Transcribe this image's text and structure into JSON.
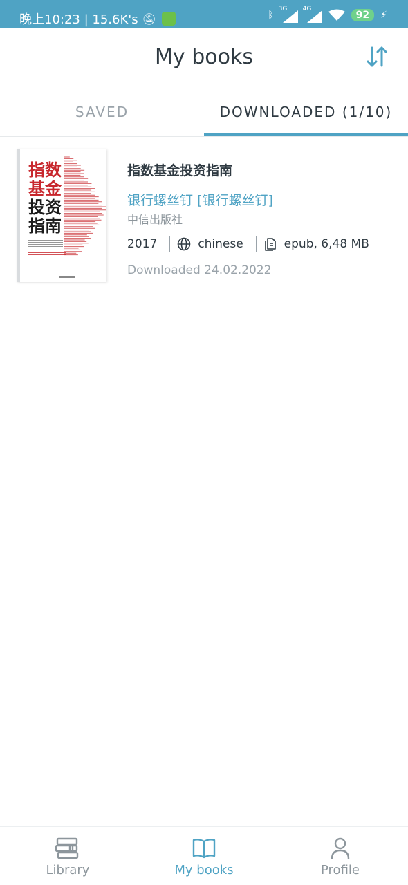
{
  "status_bar": {
    "time_speed": "晚上10:23 | 15.6K's",
    "signal1_tag": "3G",
    "signal2_tag": "4G",
    "battery": "92"
  },
  "header": {
    "title": "My books"
  },
  "tabs": [
    {
      "label": "SAVED",
      "active": false
    },
    {
      "label": "DOWNLOADED (1/10)",
      "active": true
    }
  ],
  "books": [
    {
      "title": "指数基金投资指南",
      "author": "银行螺丝钉 [银行螺丝钉]",
      "publisher": "中信出版社",
      "year": "2017",
      "language": "chinese",
      "file": "epub, 6,48 MB",
      "downloaded": "Downloaded 24.02.2022",
      "cover_text": [
        "指数",
        "基金",
        "投资",
        "指南"
      ]
    }
  ],
  "bottom_nav": [
    {
      "label": "Library",
      "icon": "library-icon",
      "active": false
    },
    {
      "label": "My books",
      "icon": "book-open-icon",
      "active": true
    },
    {
      "label": "Profile",
      "icon": "user-icon",
      "active": false
    }
  ],
  "colors": {
    "accent": "#4fa3c4",
    "status_bar": "#4fa3c4",
    "text_dark": "#2f3a42",
    "text_muted": "#9aa3aa",
    "cover_red": "#c8272d",
    "battery": "#6fd18b"
  }
}
